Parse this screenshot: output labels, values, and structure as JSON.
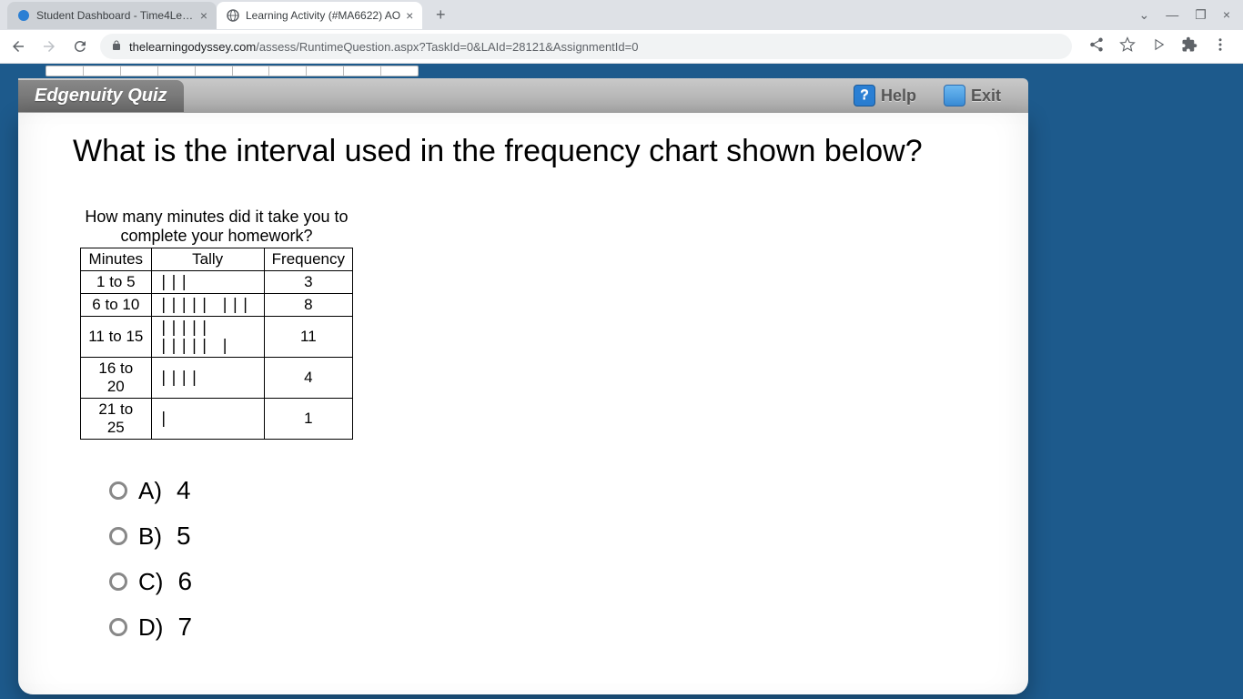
{
  "browser": {
    "tabs": [
      {
        "title": "Student Dashboard - Time4Learn",
        "favicon_color": "#2a7fd4"
      },
      {
        "title": "Learning Activity (#MA6622) AO",
        "favicon_color": "#5f6368"
      }
    ],
    "url_domain": "thelearningodyssey.com",
    "url_path": "/assess/RuntimeQuestion.aspx?TaskId=0&LAId=28121&AssignmentId=0"
  },
  "quiz": {
    "title": "Edgenuity Quiz",
    "help_label": "Help",
    "exit_label": "Exit",
    "question": "What is the interval used in the frequency chart shown below?",
    "chart_caption": "How many minutes did it take you to complete your homework?",
    "table": {
      "headers": [
        "Minutes",
        "Tally",
        "Frequency"
      ],
      "rows": [
        {
          "minutes": "1 to 5",
          "tally": "|||",
          "frequency": "3"
        },
        {
          "minutes": "6 to 10",
          "tally": "||||| |||",
          "frequency": "8"
        },
        {
          "minutes": "11 to 15",
          "tally": "||||| ||||| |",
          "frequency": "11"
        },
        {
          "minutes": "16 to 20",
          "tally": "||||",
          "frequency": "4"
        },
        {
          "minutes": "21 to 25",
          "tally": "|",
          "frequency": "1"
        }
      ]
    },
    "answers": [
      {
        "letter": "A)",
        "value": "4"
      },
      {
        "letter": "B)",
        "value": "5"
      },
      {
        "letter": "C)",
        "value": "6"
      },
      {
        "letter": "D)",
        "value": "7"
      }
    ]
  }
}
